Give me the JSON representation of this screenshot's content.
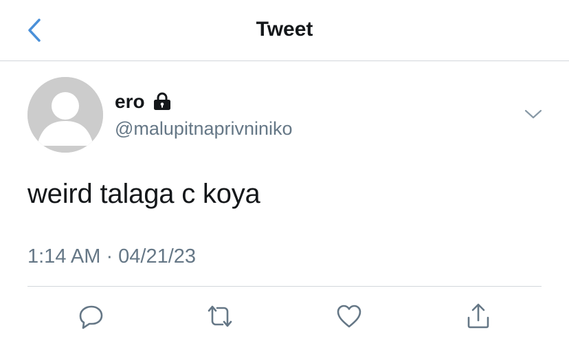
{
  "header": {
    "title": "Tweet",
    "back_icon": "chevron-left-icon"
  },
  "author": {
    "display_name": "ero",
    "handle": "@malupitnaprivniniko",
    "protected_icon": "lock-icon",
    "avatar_icon": "default-avatar-icon"
  },
  "tweet": {
    "text": "weird talaga c koya",
    "timestamp": "1:14 AM · 04/21/23"
  },
  "actions": [
    "reply-icon",
    "retweet-icon",
    "like-icon",
    "share-icon"
  ],
  "colors": {
    "accent": "#4a90d9",
    "text_primary": "#14171a",
    "text_secondary": "#657786",
    "divider": "#d2d6da",
    "avatar_bg": "#cccccc"
  }
}
